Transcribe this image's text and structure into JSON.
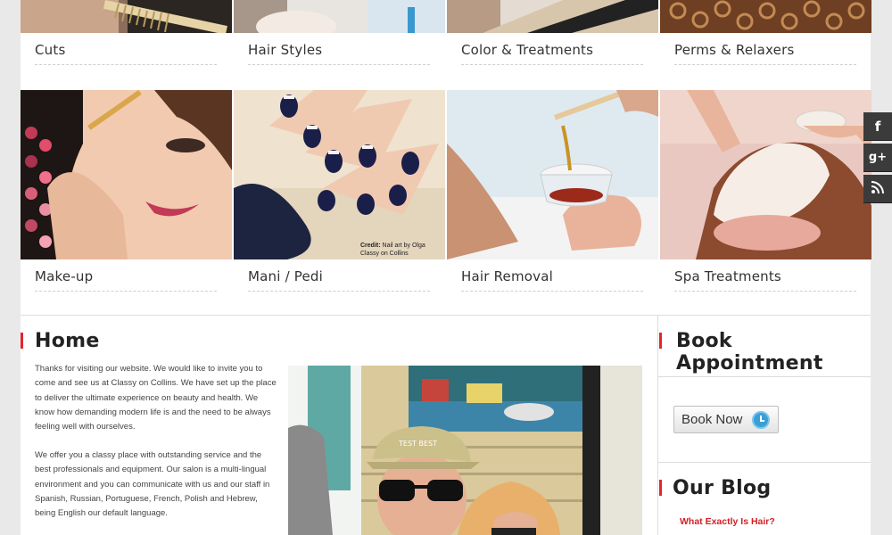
{
  "services": [
    {
      "label": "Cuts"
    },
    {
      "label": "Hair Styles"
    },
    {
      "label": "Color & Treatments"
    },
    {
      "label": "Perms & Relaxers"
    },
    {
      "label": "Make-up"
    },
    {
      "label": "Mani / Pedi",
      "credit_prefix": "Credit:",
      "credit_text": " Nail art by Olga",
      "credit_line2": "Classy on Collins"
    },
    {
      "label": "Hair Removal"
    },
    {
      "label": "Spa Treatments"
    }
  ],
  "home": {
    "title": "Home",
    "paragraphs": [
      "Thanks for visiting our website. We would like to invite you to come and see us at Classy on Collins. We have set up the place to deliver the ultimate experience on beauty and health. We know how demanding modern life is and the need to be always feeling well with ourselves.",
      "We offer you a classy place with outstanding service and the best professionals and equipment. Our salon is a multi-lingual environment and you can communicate with us and our staff in Spanish, Russian, Portuguese, French, Polish and Hebrew, being English our default language."
    ],
    "cap_text": "TEST BEST"
  },
  "sidebar": {
    "book_title": "Book Appointment",
    "book_button": "Book Now",
    "blog_title": "Our Blog",
    "blog_link": "What Exactly Is Hair?"
  },
  "social": [
    {
      "icon": "facebook-icon",
      "glyph": "f"
    },
    {
      "icon": "google-plus-icon",
      "glyph": "g+"
    },
    {
      "icon": "rss-icon",
      "glyph": "rss"
    }
  ],
  "colors": {
    "accent": "#e1262c",
    "link": "#d21f26",
    "social_bg": "#3b3b3b"
  }
}
